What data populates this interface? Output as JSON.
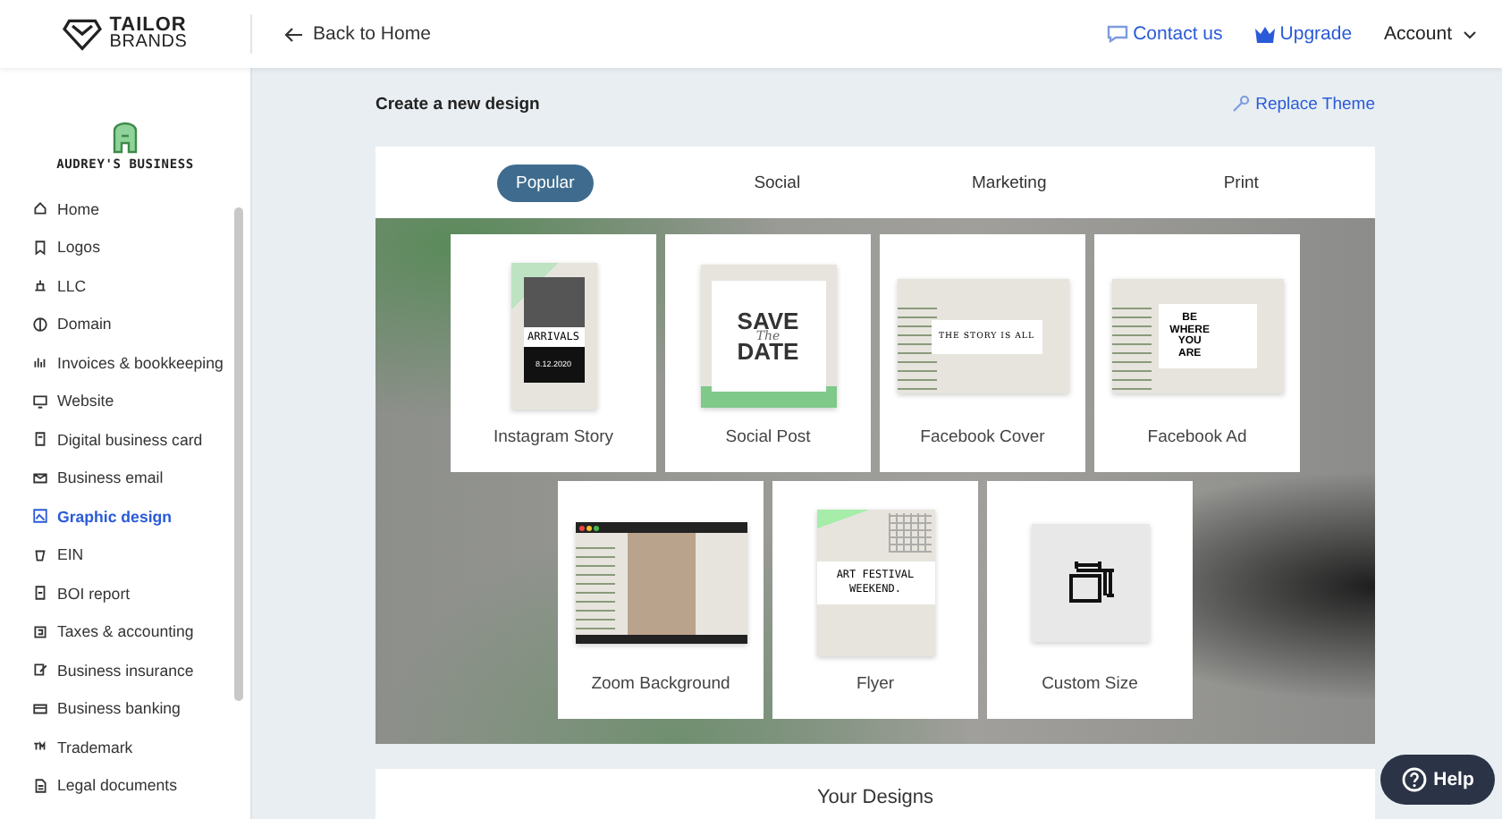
{
  "header": {
    "logo": [
      "TAILOR",
      "BRANDS"
    ],
    "back_link": "Back to Home",
    "links": [
      {
        "kind": "contact",
        "label": "Contact us"
      },
      {
        "kind": "upgrade",
        "label": "Upgrade"
      }
    ],
    "account": "Account"
  },
  "sidebar": {
    "business_name": "AUDREY'S BUSINESS",
    "items": [
      {
        "label": "Home",
        "selected": false
      },
      {
        "label": "Logos",
        "selected": false
      },
      {
        "label": "LLC",
        "selected": false
      },
      {
        "label": "Domain",
        "selected": false
      },
      {
        "label": "Invoices & bookkeeping",
        "selected": false
      },
      {
        "label": "Website",
        "selected": false
      },
      {
        "label": "Digital business card",
        "selected": false
      },
      {
        "label": "Business email",
        "selected": false
      },
      {
        "label": "Graphic design",
        "selected": true
      },
      {
        "label": "EIN",
        "selected": false
      },
      {
        "label": "BOI report",
        "selected": false
      },
      {
        "label": "Taxes & accounting",
        "selected": false
      },
      {
        "label": "Business insurance",
        "selected": false
      },
      {
        "label": "Business banking",
        "selected": false
      },
      {
        "label": "Trademark",
        "selected": false
      },
      {
        "label": "Legal documents",
        "selected": false
      }
    ]
  },
  "main": {
    "title": "Create a new design",
    "replace_theme": "Replace Theme",
    "tabs": [
      {
        "label": "Popular",
        "selected": true
      },
      {
        "label": "Social",
        "selected": false
      },
      {
        "label": "Marketing",
        "selected": false
      },
      {
        "label": "Print",
        "selected": false
      }
    ],
    "cards": [
      {
        "kind": "story",
        "label": "Instagram Story",
        "texts": [
          "ARRIVALS",
          "8.12.2020"
        ]
      },
      {
        "kind": "post",
        "label": "Social Post",
        "texts": [
          "SAVE",
          "The",
          "DATE"
        ]
      },
      {
        "kind": "cover",
        "label": "Facebook Cover",
        "texts": [
          "THE STORY IS ALL"
        ]
      },
      {
        "kind": "ad",
        "label": "Facebook Ad",
        "texts": [
          "BE",
          "WHERE",
          "YOU",
          "ARE"
        ]
      },
      {
        "kind": "zoom",
        "label": "Zoom Background"
      },
      {
        "kind": "flyer",
        "label": "Flyer",
        "texts": [
          "ART FESTIVAL",
          "WEEKEND."
        ]
      },
      {
        "kind": "custom",
        "label": "Custom Size"
      }
    ],
    "your_designs": "Your Designs"
  },
  "help_button": "Help"
}
